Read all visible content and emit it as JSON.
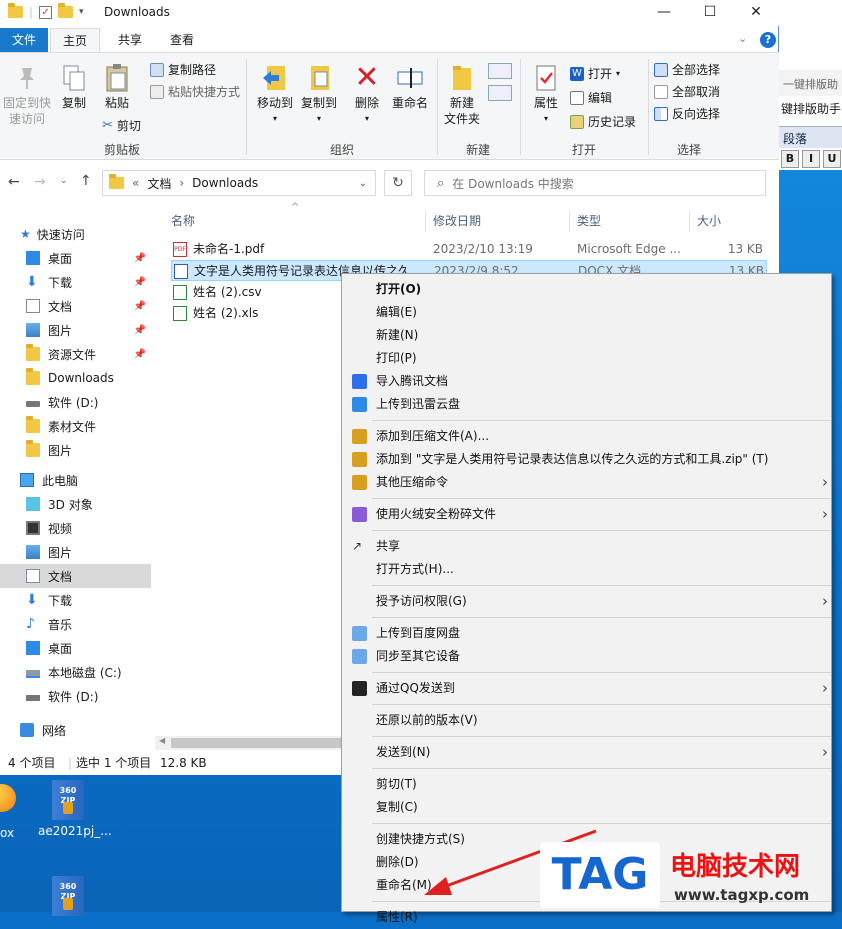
{
  "window": {
    "title": "Downloads",
    "controls": {
      "minimize": "—",
      "maximize": "☐",
      "close": "✕"
    }
  },
  "ribbon_tabs": [
    "文件",
    "主页",
    "共享",
    "查看"
  ],
  "ribbon": {
    "pin_quick": "固定到快\n速访问",
    "copy": "复制",
    "paste": "粘贴",
    "copy_path": "复制路径",
    "paste_shortcut": "粘贴快捷方式",
    "cut": "剪切",
    "group_clipboard": "剪贴板",
    "move_to": "移动到",
    "copy_to": "复制到",
    "delete": "删除",
    "rename": "重命名",
    "group_organize": "组织",
    "new_folder": "新建\n文件夹",
    "group_new": "新建",
    "properties": "属性",
    "open": "打开",
    "edit": "编辑",
    "history": "历史记录",
    "group_open": "打开",
    "select_all": "全部选择",
    "select_none": "全部取消",
    "invert": "反向选择",
    "group_select": "选择"
  },
  "address": {
    "prefix": "«",
    "crumb1": "文档",
    "sep": "›",
    "crumb2": "Downloads"
  },
  "search": {
    "placeholder": "在 Downloads 中搜索"
  },
  "nav": {
    "quick_access": "快速访问",
    "items": [
      {
        "label": "桌面",
        "pinned": true
      },
      {
        "label": "下载",
        "pinned": true
      },
      {
        "label": "文档",
        "pinned": true
      },
      {
        "label": "图片",
        "pinned": true
      },
      {
        "label": "资源文件",
        "pinned": true
      },
      {
        "label": "Downloads"
      },
      {
        "label": "软件 (D:)"
      },
      {
        "label": "素材文件"
      },
      {
        "label": "图片"
      }
    ],
    "this_pc": "此电脑",
    "pc_items": [
      "3D 对象",
      "视频",
      "图片",
      "文档",
      "下载",
      "音乐",
      "桌面",
      "本地磁盘 (C:)",
      "软件 (D:)"
    ],
    "network": "网络"
  },
  "columns": {
    "name": "名称",
    "date": "修改日期",
    "type": "类型",
    "size": "大小"
  },
  "files": [
    {
      "name": "未命名-1.pdf",
      "date": "2023/2/10 13:19",
      "type": "Microsoft Edge ...",
      "size": "13 KB"
    },
    {
      "name": "文字是人类用符号记录表达信息以传之久",
      "date": "2023/2/9 8:52",
      "type": "DOCX 文档",
      "size": "13 KB"
    },
    {
      "name": "姓名 (2).csv",
      "date": "",
      "type": "",
      "size": ""
    },
    {
      "name": "姓名 (2).xls",
      "date": "",
      "type": "",
      "size": ""
    }
  ],
  "status": {
    "count": "4 个项目",
    "selected": "选中 1 个项目",
    "size": "12.8 KB"
  },
  "desktop": {
    "icon1": "ae2021pj_...",
    "icon_left": "ox"
  },
  "bgapp": {
    "line1": "一键排版助",
    "line2": "键排版助手",
    "line3": "段落",
    "btns": [
      "B",
      "I",
      "U"
    ]
  },
  "context_menu": [
    {
      "label": "打开(O)",
      "bold": true
    },
    {
      "label": "编辑(E)"
    },
    {
      "label": "新建(N)"
    },
    {
      "label": "打印(P)"
    },
    {
      "label": "导入腾讯文档",
      "icon": "tencent-docs-icon"
    },
    {
      "label": "上传到迅雷云盘",
      "icon": "xunlei-icon"
    },
    {
      "sep": true
    },
    {
      "label": "添加到压缩文件(A)...",
      "icon": "archive-icon"
    },
    {
      "label": "添加到 \"文字是人类用符号记录表达信息以传之久远的方式和工具.zip\" (T)",
      "icon": "archive-icon"
    },
    {
      "label": "其他压缩命令",
      "icon": "archive-icon",
      "sub": true
    },
    {
      "sep": true
    },
    {
      "label": "使用火绒安全粉碎文件",
      "icon": "huorong-icon",
      "sub": true
    },
    {
      "sep": true
    },
    {
      "label": "共享",
      "icon": "share-icon"
    },
    {
      "label": "打开方式(H)..."
    },
    {
      "sep": true
    },
    {
      "label": "授予访问权限(G)",
      "sub": true
    },
    {
      "sep": true
    },
    {
      "label": "上传到百度网盘",
      "icon": "baidu-icon"
    },
    {
      "label": "同步至其它设备",
      "icon": "baidu-icon"
    },
    {
      "sep": true
    },
    {
      "label": "通过QQ发送到",
      "icon": "qq-icon",
      "sub": true
    },
    {
      "sep": true
    },
    {
      "label": "还原以前的版本(V)"
    },
    {
      "sep": true
    },
    {
      "label": "发送到(N)",
      "sub": true
    },
    {
      "sep": true
    },
    {
      "label": "剪切(T)"
    },
    {
      "label": "复制(C)"
    },
    {
      "sep": true
    },
    {
      "label": "创建快捷方式(S)"
    },
    {
      "label": "删除(D)"
    },
    {
      "label": "重命名(M)"
    },
    {
      "sep": true
    },
    {
      "label": "属性(R)"
    }
  ],
  "watermark": {
    "tag": "TAG",
    "cn": "电脑技术网",
    "url": "www.tagxp.com"
  },
  "colors": {
    "accent": "#1979ca",
    "selected_row": "#cce8ff",
    "arrow": "#e02020"
  }
}
